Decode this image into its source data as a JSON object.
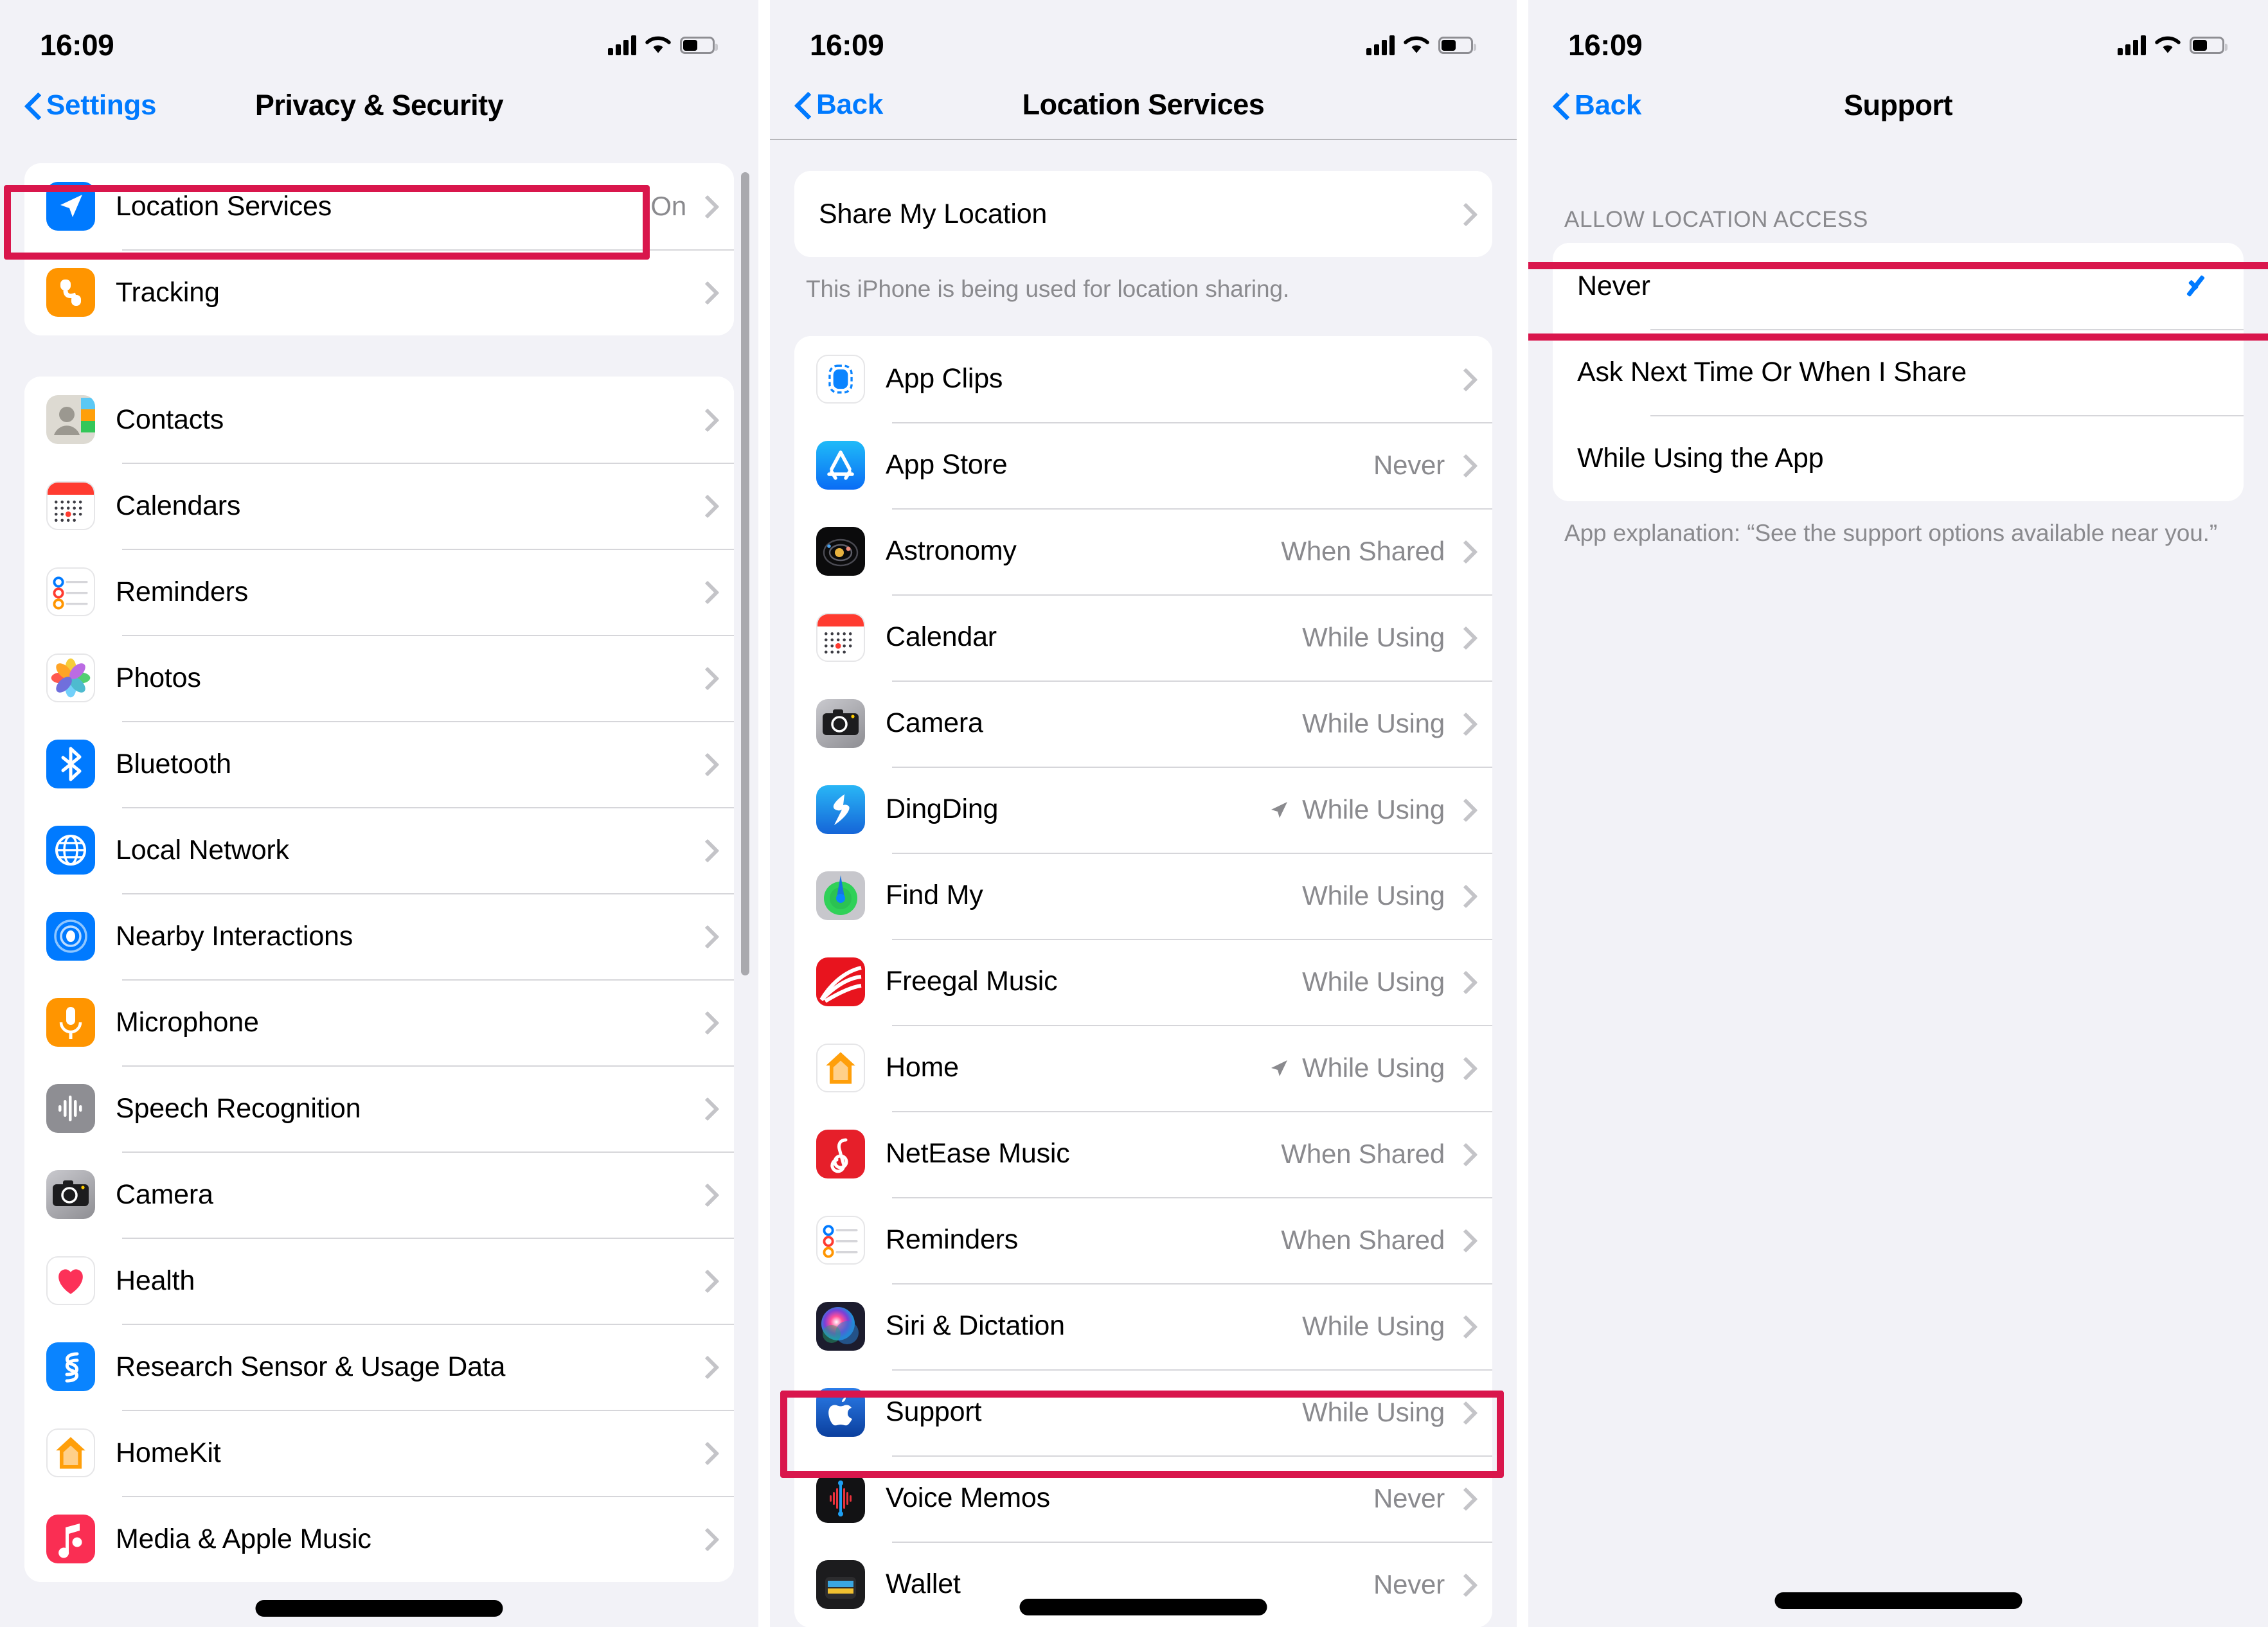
{
  "statusbar": {
    "time": "16:09",
    "signal_icon": "cellular-bars-icon",
    "wifi_icon": "wifi-icon",
    "battery_icon": "battery-icon"
  },
  "highlight_color": "#d9164c",
  "accent_color": "#007aff",
  "panel1": {
    "nav": {
      "back_label": "Settings",
      "title": "Privacy & Security"
    },
    "group_top": [
      {
        "icon": "location-services-icon",
        "label": "Location Services",
        "value": "On"
      },
      {
        "icon": "tracking-icon",
        "label": "Tracking",
        "value": ""
      }
    ],
    "group_main": [
      {
        "icon": "contacts-icon",
        "label": "Contacts",
        "value": ""
      },
      {
        "icon": "calendars-icon",
        "label": "Calendars",
        "value": ""
      },
      {
        "icon": "reminders-icon",
        "label": "Reminders",
        "value": ""
      },
      {
        "icon": "photos-icon",
        "label": "Photos",
        "value": ""
      },
      {
        "icon": "bluetooth-icon",
        "label": "Bluetooth",
        "value": ""
      },
      {
        "icon": "local-network-icon",
        "label": "Local Network",
        "value": ""
      },
      {
        "icon": "nearby-interactions-icon",
        "label": "Nearby Interactions",
        "value": ""
      },
      {
        "icon": "microphone-icon",
        "label": "Microphone",
        "value": ""
      },
      {
        "icon": "speech-recognition-icon",
        "label": "Speech Recognition",
        "value": ""
      },
      {
        "icon": "camera-icon",
        "label": "Camera",
        "value": ""
      },
      {
        "icon": "health-icon",
        "label": "Health",
        "value": ""
      },
      {
        "icon": "research-sensor-icon",
        "label": "Research Sensor & Usage Data",
        "value": ""
      },
      {
        "icon": "homekit-icon",
        "label": "HomeKit",
        "value": ""
      },
      {
        "icon": "media-apple-music-icon",
        "label": "Media & Apple Music",
        "value": ""
      }
    ]
  },
  "panel2": {
    "nav": {
      "back_label": "Back",
      "title": "Location Services"
    },
    "share_row": {
      "label": "Share My Location",
      "value": ""
    },
    "share_footnote": "This iPhone is being used for location sharing.",
    "apps": [
      {
        "icon": "app-clips-icon",
        "label": "App Clips",
        "value": "",
        "arrow": false
      },
      {
        "icon": "app-store-icon",
        "label": "App Store",
        "value": "Never",
        "arrow": false
      },
      {
        "icon": "astronomy-icon",
        "label": "Astronomy",
        "value": "When Shared",
        "arrow": false
      },
      {
        "icon": "calendar-icon",
        "label": "Calendar",
        "value": "While Using",
        "arrow": false
      },
      {
        "icon": "camera-icon",
        "label": "Camera",
        "value": "While Using",
        "arrow": false
      },
      {
        "icon": "dingding-icon",
        "label": "DingDing",
        "value": "While Using",
        "arrow": true
      },
      {
        "icon": "find-my-icon",
        "label": "Find My",
        "value": "While Using",
        "arrow": false
      },
      {
        "icon": "freegal-music-icon",
        "label": "Freegal Music",
        "value": "While Using",
        "arrow": false
      },
      {
        "icon": "home-icon",
        "label": "Home",
        "value": "While Using",
        "arrow": true
      },
      {
        "icon": "netease-music-icon",
        "label": "NetEase Music",
        "value": "When Shared",
        "arrow": false
      },
      {
        "icon": "reminders-icon",
        "label": "Reminders",
        "value": "When Shared",
        "arrow": false
      },
      {
        "icon": "siri-dictation-icon",
        "label": "Siri & Dictation",
        "value": "While Using",
        "arrow": false
      },
      {
        "icon": "support-icon",
        "label": "Support",
        "value": "While Using",
        "arrow": false
      },
      {
        "icon": "voice-memos-icon",
        "label": "Voice Memos",
        "value": "Never",
        "arrow": false
      },
      {
        "icon": "wallet-icon",
        "label": "Wallet",
        "value": "Never",
        "arrow": false
      }
    ]
  },
  "panel3": {
    "nav": {
      "back_label": "Back",
      "title": "Support"
    },
    "section_header": "ALLOW LOCATION ACCESS",
    "options": [
      {
        "label": "Never",
        "selected": true
      },
      {
        "label": "Ask Next Time Or When I Share",
        "selected": false
      },
      {
        "label": "While Using the App",
        "selected": false
      }
    ],
    "footnote": "App explanation: “See the support options available near you.”"
  }
}
